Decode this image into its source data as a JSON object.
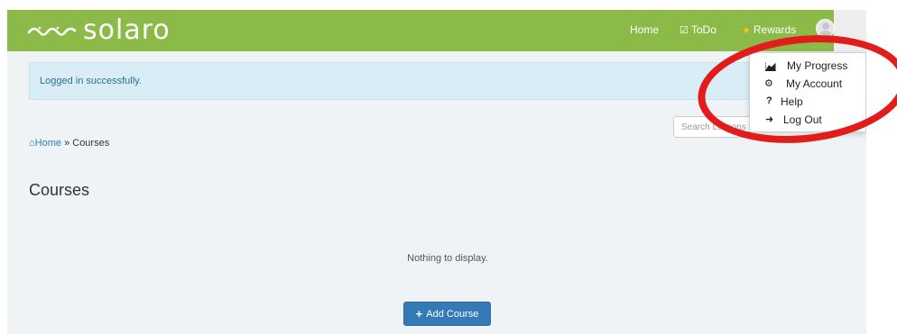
{
  "brand": {
    "name": "solaro",
    "logo_icon": "solaro-wave-icon"
  },
  "nav": {
    "home": "Home",
    "todo": "ToDo",
    "rewards": "Rewards"
  },
  "alert": {
    "message": "Logged in successfully."
  },
  "search": {
    "placeholder": "Search Lessons"
  },
  "breadcrumb": {
    "home": "Home",
    "separator": "»",
    "current": "Courses"
  },
  "page": {
    "title": "Courses",
    "empty_text": "Nothing to display.",
    "add_label": "Add Course"
  },
  "menu": {
    "items": [
      {
        "label": "My Progress",
        "icon": "chart-area-icon"
      },
      {
        "label": "My Account",
        "icon": "cogs-icon"
      },
      {
        "label": "Help",
        "icon": "question-icon"
      },
      {
        "label": "Log Out",
        "icon": "sign-out-icon"
      }
    ]
  },
  "colors": {
    "navbar": "#8cba48",
    "alert_bg": "#d9edf7",
    "primary": "#337ab7",
    "highlight_circle": "#e21b1b"
  }
}
